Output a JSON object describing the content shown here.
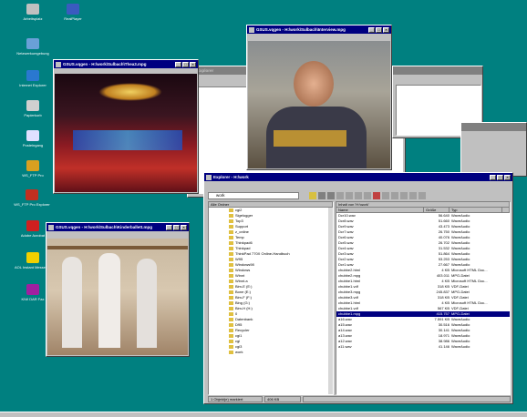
{
  "desktop_icons": [
    {
      "label": "Arbeitsplatz",
      "color": "#c0c0c0"
    },
    {
      "label": "RealPlayer",
      "color": "#3a5bbf"
    },
    {
      "label": "Netzwerkumgebung",
      "color": "#6aa0d8"
    },
    {
      "label": "Internet Explorer",
      "color": "#2a78d0"
    },
    {
      "label": "Papierkorb",
      "color": "#d0d0d0"
    },
    {
      "label": "Posteingang",
      "color": "#e0e0ff"
    },
    {
      "label": "WS_FTP Pro",
      "color": "#d8a020"
    },
    {
      "label": "WS_FTP Pro Explorer",
      "color": "#c03020"
    },
    {
      "label": "Adobe Acrobat",
      "color": "#d02020"
    },
    {
      "label": "AOL Instant Messenger",
      "color": "#f0d000"
    },
    {
      "label": "KIW DAR Fax",
      "color": "#a020a0"
    }
  ],
  "sample_video_window": {
    "title": "GSUS.vqgen - H:\\work\\Sulbach\\Thea3.mpg"
  },
  "back_explorer_window": {
    "title": "Explorer"
  },
  "portrait_video_window": {
    "title": "GSUS.vqgen - H:\\work\\Sulbach\\Interview.mpg"
  },
  "dance_video_window": {
    "title": "GSUS.vqgen - H:\\work\\Sulbach\\Kinderballett.mpg"
  },
  "explorer": {
    "title": "Explorer - H:\\work",
    "address_value": "work",
    "left_header": "Alle Ordner",
    "right_header": "Inhalt von 'H:\\work'",
    "tree": [
      "cgi2",
      "Sigelogger",
      "Top3",
      "Support",
      "z_online",
      "Temp",
      "Thinkpad6",
      "Thinkpad",
      "ThinkPad 770X Online-Handbuch",
      "W95",
      "Windows98",
      "Windows",
      "Winnt",
      "Winnt.a",
      "Bim-E (E:)",
      "Bone (E:)",
      "Bim-F (F:)",
      "Bing (G:)",
      "Bim-H (H:)",
      "0",
      "Datenbank",
      "D95",
      "Recycler",
      "cgi1",
      "cgi",
      "cgi3",
      "work"
    ],
    "columns": [
      "Name",
      "Größe",
      "Typ",
      ""
    ],
    "files": [
      {
        "name": "Dcr10.wav",
        "size": "56.640",
        "type": "WaveAudio"
      },
      {
        "name": "Dcr8.wav",
        "size": "51.660",
        "type": "WaveAudio"
      },
      {
        "name": "Dcr9.wav",
        "size": "43.473",
        "type": "WaveAudio"
      },
      {
        "name": "Dcr7.wav",
        "size": "26.750",
        "type": "WaveAudio"
      },
      {
        "name": "Dcr6.wav",
        "size": "40.076",
        "type": "WaveAudio"
      },
      {
        "name": "Dcr5.wav",
        "size": "26.702",
        "type": "WaveAudio"
      },
      {
        "name": "Dcr4.wav",
        "size": "31.532",
        "type": "WaveAudio"
      },
      {
        "name": "Dcr3.wav",
        "size": "51.864",
        "type": "WaveAudio"
      },
      {
        "name": "Dcr2.wav",
        "size": "53.253",
        "type": "WaveAudio"
      },
      {
        "name": "Dcr1.wav",
        "size": "27.667",
        "type": "WaveAudio"
      },
      {
        "name": "chubbe2.html",
        "size": "4 KB",
        "type": "Microsoft HTML Doc..."
      },
      {
        "name": "chubbe2.mpg",
        "size": "403.011",
        "type": "MPG-Datei"
      },
      {
        "name": "chubbe1.html",
        "size": "4 KB",
        "type": "Microsoft HTML Doc..."
      },
      {
        "name": "chubbe1.vdf",
        "size": "318 KB",
        "type": "VDF-Datei"
      },
      {
        "name": "chubbe3.mpg",
        "size": "245.837",
        "type": "MPG-Datei"
      },
      {
        "name": "chubbe3.vdf",
        "size": "318 KB",
        "type": "VDF-Datei"
      },
      {
        "name": "chubbe1.html",
        "size": "4 KB",
        "type": "Microsoft HTML Doc..."
      },
      {
        "name": "chubbe1.vdf",
        "size": "567 KB",
        "type": "VDF-Datei"
      },
      {
        "name": "chubbe1.mpg",
        "size": "415.757",
        "type": "MPG-Datei"
      },
      {
        "name": "a16.wav",
        "size": "7.591 KB",
        "type": "WaveAudio"
      },
      {
        "name": "a15.wav",
        "size": "30.516",
        "type": "WaveAudio"
      },
      {
        "name": "a14.wav",
        "size": "30.141",
        "type": "WaveAudio"
      },
      {
        "name": "a13.wav",
        "size": "18.971",
        "type": "WaveAudio"
      },
      {
        "name": "a12.wav",
        "size": "38.986",
        "type": "WaveAudio"
      },
      {
        "name": "a11.wav",
        "size": "41.146",
        "type": "WaveAudio"
      }
    ],
    "status_left": "1 Objekt(e) markiert",
    "status_right": "406 KB"
  },
  "colors": {
    "desktop": "#008080",
    "titlebar": "#000080",
    "window": "#c0c0c0"
  }
}
